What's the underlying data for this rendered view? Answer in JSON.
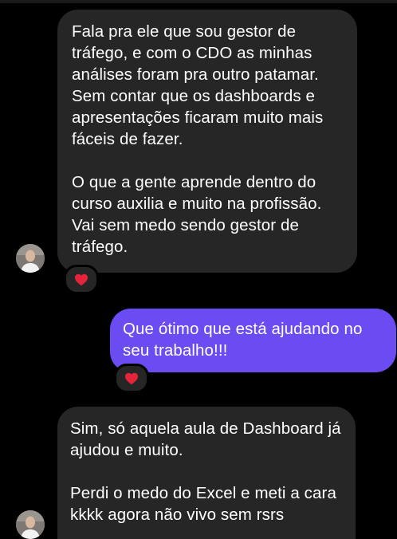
{
  "colors": {
    "background": "#000000",
    "incoming_bubble": "#262626",
    "outgoing_bubble": "#6b4bf2",
    "heart": "#e5243b"
  },
  "messages": [
    {
      "direction": "incoming",
      "paragraphs": [
        "Fala pra ele que sou gestor de tráfego, e com o CDO as minhas análises foram pra outro patamar. Sem contar que os dashboards e apresentações ficaram muito mais fáceis de fazer.",
        "O que a gente aprende dentro do curso auxilia e muito na profissão. Vai sem medo sendo gestor de tráfego."
      ],
      "reaction": "heart-icon"
    },
    {
      "direction": "outgoing",
      "paragraphs": [
        "Que ótimo que está ajudando no seu trabalho!!!"
      ],
      "reaction": "heart-icon"
    },
    {
      "direction": "incoming",
      "paragraphs": [
        "Sim, só aquela aula de Dashboard já ajudou e muito.",
        "Perdi o medo do Excel e meti a cara kkkk agora não vivo sem rsrs"
      ]
    }
  ]
}
